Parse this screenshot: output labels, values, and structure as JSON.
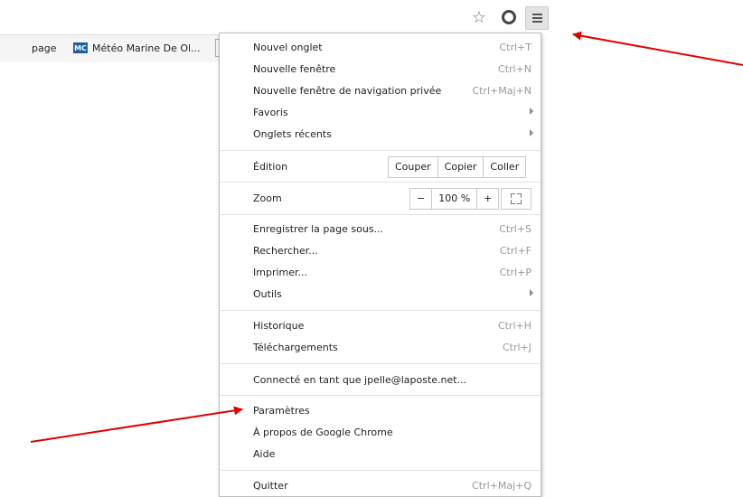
{
  "toolbar": {
    "icons": [
      "star-icon",
      "opera-icon",
      "menu-icon"
    ]
  },
  "bookmarks": {
    "page_label": "page",
    "mc_badge": "MC",
    "meteo_label": "Météo Marine De Ol..."
  },
  "menu": {
    "new_tab": {
      "label": "Nouvel onglet",
      "shortcut": "Ctrl+T"
    },
    "new_window": {
      "label": "Nouvelle fenêtre",
      "shortcut": "Ctrl+N"
    },
    "private_window": {
      "label": "Nouvelle fenêtre de navigation privée",
      "shortcut": "Ctrl+Maj+N"
    },
    "bookmarks": {
      "label": "Favoris"
    },
    "recent_tabs": {
      "label": "Onglets récents"
    },
    "edit": {
      "label": "Édition",
      "cut": "Couper",
      "copy": "Copier",
      "paste": "Coller"
    },
    "zoom": {
      "label": "Zoom",
      "minus": "−",
      "value": "100 %",
      "plus": "+"
    },
    "save_page": {
      "label": "Enregistrer la page sous...",
      "shortcut": "Ctrl+S"
    },
    "find": {
      "label": "Rechercher...",
      "shortcut": "Ctrl+F"
    },
    "print": {
      "label": "Imprimer...",
      "shortcut": "Ctrl+P"
    },
    "tools": {
      "label": "Outils"
    },
    "history": {
      "label": "Historique",
      "shortcut": "Ctrl+H"
    },
    "downloads": {
      "label": "Téléchargements",
      "shortcut": "Ctrl+J"
    },
    "signed_in": {
      "label": "Connecté en tant que jpelle@laposte.net..."
    },
    "settings": {
      "label": "Paramètres"
    },
    "about": {
      "label": "À propos de Google Chrome"
    },
    "help": {
      "label": "Aide"
    },
    "quit": {
      "label": "Quitter",
      "shortcut": "Ctrl+Maj+Q"
    }
  },
  "colors": {
    "arrow": "#e00000",
    "menu_border": "#bdbdbd",
    "shortcut_text": "#999999"
  }
}
